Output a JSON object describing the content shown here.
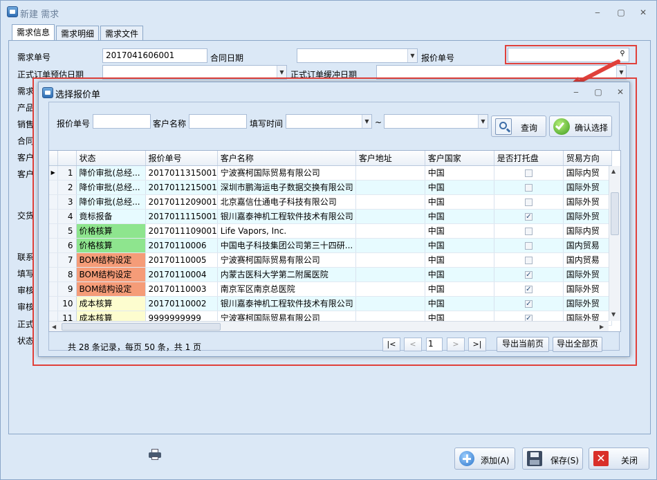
{
  "window": {
    "title": "新建 需求",
    "min": "‒",
    "max": "▢",
    "close": "✕"
  },
  "tabs": [
    "需求信息",
    "需求明细",
    "需求文件"
  ],
  "form": {
    "req_no_label": "需求单号",
    "req_no_value": "2017041606001",
    "contract_date_label": "合同日期",
    "quote_no_label": "报价单号",
    "formal_est_label": "正式订单预估日期",
    "formal_buffer_label": "正式订单缓冲日期",
    "side_labels": [
      "需求",
      "产品",
      "销售",
      "合同",
      "客户",
      "客户",
      "交货",
      "联系",
      "填写",
      "审核",
      "审核",
      "正式",
      "状态"
    ]
  },
  "dialog": {
    "title": "选择报价单",
    "search": {
      "quote_no_label": "报价单号",
      "customer_label": "客户名称",
      "time_label": "填写时间",
      "tilde": "~",
      "query_btn": "查询",
      "confirm_btn": "确认选择"
    },
    "columns": [
      "状态",
      "报价单号",
      "客户名称",
      "客户地址",
      "客户国家",
      "是否打托盘",
      "贸易方向"
    ],
    "rows": [
      {
        "n": "1",
        "status": "降价审批(总经...",
        "quote": "2017011315001",
        "customer": "宁波赛柯国际贸易有限公司",
        "addr": "",
        "country": "中国",
        "pallet": false,
        "dir": "国际内贸",
        "color": "#e7fbff"
      },
      {
        "n": "2",
        "status": "降价审批(总经...",
        "quote": "2017011215001",
        "customer": "深圳市鹏海运电子数据交换有限公司",
        "addr": "",
        "country": "中国",
        "pallet": false,
        "dir": "国际外贸",
        "color": "#e7fbff"
      },
      {
        "n": "3",
        "status": "降价审批(总经...",
        "quote": "2017011209001",
        "customer": "北京嘉信仕通电子科技有限公司",
        "addr": "",
        "country": "中国",
        "pallet": false,
        "dir": "国际外贸",
        "color": "#e7fbff"
      },
      {
        "n": "4",
        "status": "竟标报备",
        "quote": "2017011115001",
        "customer": "银川嘉泰神机工程软件技术有限公司",
        "addr": "",
        "country": "中国",
        "pallet": true,
        "dir": "国际外贸",
        "color": "#e7fbff"
      },
      {
        "n": "5",
        "status": "价格核算",
        "quote": "2017011109001",
        "customer": "Life Vapors, Inc.",
        "addr": "",
        "country": "中国",
        "pallet": false,
        "dir": "国际内贸",
        "color": "#8ee58e"
      },
      {
        "n": "6",
        "status": "价格核算",
        "quote": "20170110006",
        "customer": "中国电子科技集团公司第三十四研...",
        "addr": "",
        "country": "中国",
        "pallet": false,
        "dir": "国内贸易",
        "color": "#8ee58e"
      },
      {
        "n": "7",
        "status": "BOM结构设定",
        "quote": "20170110005",
        "customer": "宁波赛柯国际贸易有限公司",
        "addr": "",
        "country": "中国",
        "pallet": false,
        "dir": "国内贸易",
        "color": "#f59c78"
      },
      {
        "n": "8",
        "status": "BOM结构设定",
        "quote": "20170110004",
        "customer": "内蒙古医科大学第二附属医院",
        "addr": "",
        "country": "中国",
        "pallet": true,
        "dir": "国际外贸",
        "color": "#f59c78"
      },
      {
        "n": "9",
        "status": "BOM结构设定",
        "quote": "20170110003",
        "customer": "南京军区南京总医院",
        "addr": "",
        "country": "中国",
        "pallet": true,
        "dir": "国际外贸",
        "color": "#f59c78"
      },
      {
        "n": "10",
        "status": "成本核算",
        "quote": "20170110002",
        "customer": "银川嘉泰神机工程软件技术有限公司",
        "addr": "",
        "country": "中国",
        "pallet": true,
        "dir": "国际外贸",
        "color": "#fdfdcf"
      },
      {
        "n": "11",
        "status": "成本核算",
        "quote": "9999999999",
        "customer": "宁波赛柯国际贸易有限公司",
        "addr": "",
        "country": "中国",
        "pallet": true,
        "dir": "国际外贸",
        "color": "#fdfdcf"
      }
    ],
    "footer": {
      "summary": "共 28 条记录，每页 50 条，共 1 页",
      "first": "|<",
      "prev": "<",
      "page": "1",
      "next": ">",
      "last": ">|",
      "export_page": "导出当前页",
      "export_all": "导出全部页"
    }
  },
  "bottom": {
    "add": "添加(A)",
    "save": "保存(S)",
    "close": "关闭"
  }
}
